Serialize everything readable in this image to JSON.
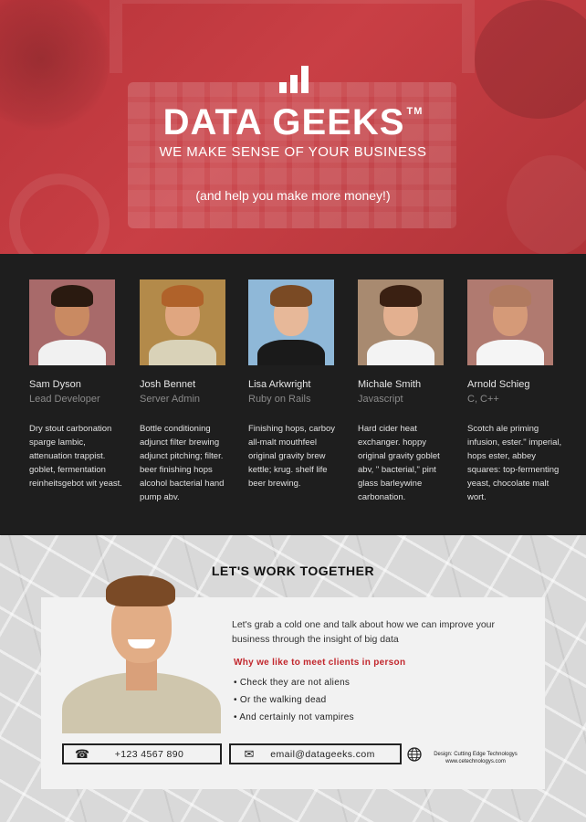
{
  "hero": {
    "brand": "DATA GEEKS",
    "trademark": "TM",
    "tagline": "WE MAKE SENSE OF YOUR BUSINESS",
    "subline": "(and help you make more money!)"
  },
  "team": [
    {
      "name": "Sam Dyson",
      "role": "Lead Developer",
      "desc": "Dry stout carbonation sparge lambic, attenuation trappist. goblet, fermentation reinheitsgebot wit yeast.",
      "skin": "#c98a62",
      "hair": "#2a1a10",
      "shirt": "#f1f1f1",
      "bg": "#a86a6a"
    },
    {
      "name": "Josh Bennet",
      "role": "Server Admin",
      "desc": "Bottle conditioning adjunct filter brewing adjunct pitching; filter. beer finishing hops alcohol bacterial hand pump abv.",
      "skin": "#e0a680",
      "hair": "#b0622a",
      "shirt": "#d9d2b8",
      "bg": "#b38a4a"
    },
    {
      "name": "Lisa Arkwright",
      "role": "Ruby on Rails",
      "desc": "Finishing hops, carboy all-malt mouthfeel original gravity brew kettle; krug. shelf life beer brewing.",
      "skin": "#e7b899",
      "hair": "#7a4a24",
      "shirt": "#1a1a1a",
      "bg": "#8fb8d8"
    },
    {
      "name": "Michale Smith",
      "role": "Javascript",
      "desc": "Hard cider heat exchanger. hoppy original gravity goblet abv, \" bacterial,\" pint glass barleywine carbonation.",
      "skin": "#e3b090",
      "hair": "#3a2012",
      "shirt": "#f3f3f3",
      "bg": "#a88a70"
    },
    {
      "name": "Arnold Schieg",
      "role": "C, C++",
      "desc": "Scotch ale priming infusion, ester.\" imperial, hops ester, abbey squares: top-fermenting yeast, chocolate malt wort.",
      "skin": "#d59a78",
      "hair": "#b07a60",
      "shirt": "#f5f5f5",
      "bg": "#b07a70"
    }
  ],
  "contact": {
    "title": "LET'S WORK TOGETHER",
    "intro": "Let's grab a cold one and talk about how we can improve your business through the insight of big data",
    "why_title": "Why we like to meet clients in person",
    "bullets": [
      "Check they are not aliens",
      "Or the walking dead",
      "And certainly not vampires"
    ],
    "phone": "+123 4567 890",
    "email": "email@datageeks.com",
    "credit_line1": "Design: Cutting Edge Technologys",
    "credit_line2": "www.cetechnologys.com"
  },
  "colors": {
    "hero": "#c13b41",
    "accent": "#c2272d",
    "dark": "#1e1e1e"
  },
  "icons": {
    "logo": "bar-chart-icon",
    "phone": "phone-icon",
    "email": "envelope-icon",
    "web": "globe-icon"
  }
}
